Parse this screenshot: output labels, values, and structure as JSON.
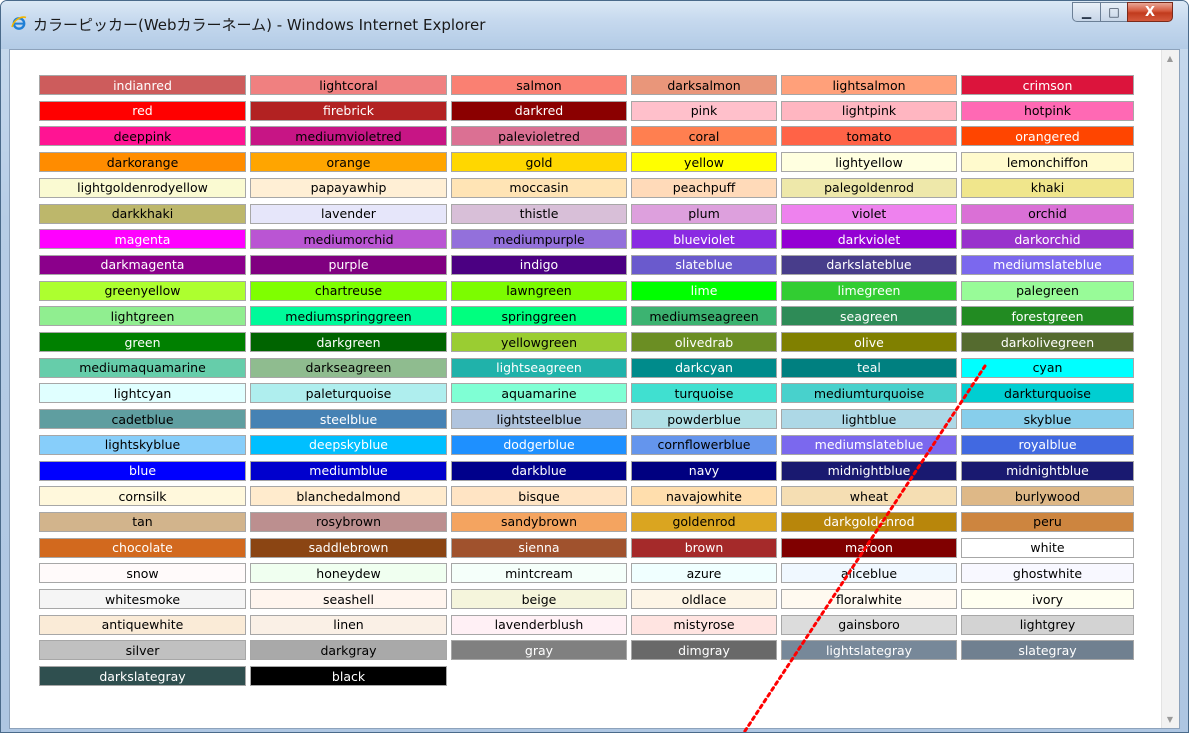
{
  "window": {
    "title": "カラーピッカー(Webカラーネーム) - Windows Internet Explorer",
    "icons": {
      "app": "ie-icon",
      "minimize": "minimize-icon",
      "maximize": "maximize-icon",
      "close": "close-icon"
    },
    "controls": {
      "minimize": "▁",
      "maximize": "□",
      "close": "X"
    }
  },
  "scrollbar": {
    "up": "▲",
    "down": "▼"
  },
  "colors": [
    {
      "name": "indianred",
      "hex": "#CD5C5C",
      "text": "#ffffff"
    },
    {
      "name": "lightcoral",
      "hex": "#F08080",
      "text": "#000000"
    },
    {
      "name": "salmon",
      "hex": "#FA8072",
      "text": "#000000"
    },
    {
      "name": "darksalmon",
      "hex": "#E9967A",
      "text": "#000000"
    },
    {
      "name": "lightsalmon",
      "hex": "#FFA07A",
      "text": "#000000"
    },
    {
      "name": "crimson",
      "hex": "#DC143C",
      "text": "#ffffff"
    },
    {
      "name": "red",
      "hex": "#FF0000",
      "text": "#ffffff"
    },
    {
      "name": "firebrick",
      "hex": "#B22222",
      "text": "#ffffff"
    },
    {
      "name": "darkred",
      "hex": "#8B0000",
      "text": "#ffffff"
    },
    {
      "name": "pink",
      "hex": "#FFC0CB",
      "text": "#000000"
    },
    {
      "name": "lightpink",
      "hex": "#FFB6C1",
      "text": "#000000"
    },
    {
      "name": "hotpink",
      "hex": "#FF69B4",
      "text": "#000000"
    },
    {
      "name": "deeppink",
      "hex": "#FF1493",
      "text": "#000000"
    },
    {
      "name": "mediumvioletred",
      "hex": "#C71585",
      "text": "#000000"
    },
    {
      "name": "palevioletred",
      "hex": "#DB7093",
      "text": "#000000"
    },
    {
      "name": "coral",
      "hex": "#FF7F50",
      "text": "#000000"
    },
    {
      "name": "tomato",
      "hex": "#FF6347",
      "text": "#000000"
    },
    {
      "name": "orangered",
      "hex": "#FF4500",
      "text": "#ffffff"
    },
    {
      "name": "darkorange",
      "hex": "#FF8C00",
      "text": "#000000"
    },
    {
      "name": "orange",
      "hex": "#FFA500",
      "text": "#000000"
    },
    {
      "name": "gold",
      "hex": "#FFD700",
      "text": "#000000"
    },
    {
      "name": "yellow",
      "hex": "#FFFF00",
      "text": "#000000"
    },
    {
      "name": "lightyellow",
      "hex": "#FFFFE0",
      "text": "#000000"
    },
    {
      "name": "lemonchiffon",
      "hex": "#FFFACD",
      "text": "#000000"
    },
    {
      "name": "lightgoldenrodyellow",
      "hex": "#FAFAD2",
      "text": "#000000"
    },
    {
      "name": "papayawhip",
      "hex": "#FFEFD5",
      "text": "#000000"
    },
    {
      "name": "moccasin",
      "hex": "#FFE4B5",
      "text": "#000000"
    },
    {
      "name": "peachpuff",
      "hex": "#FFDAB9",
      "text": "#000000"
    },
    {
      "name": "palegoldenrod",
      "hex": "#EEE8AA",
      "text": "#000000"
    },
    {
      "name": "khaki",
      "hex": "#F0E68C",
      "text": "#000000"
    },
    {
      "name": "darkkhaki",
      "hex": "#BDB76B",
      "text": "#000000"
    },
    {
      "name": "lavender",
      "hex": "#E6E6FA",
      "text": "#000000"
    },
    {
      "name": "thistle",
      "hex": "#D8BFD8",
      "text": "#000000"
    },
    {
      "name": "plum",
      "hex": "#DDA0DD",
      "text": "#000000"
    },
    {
      "name": "violet",
      "hex": "#EE82EE",
      "text": "#000000"
    },
    {
      "name": "orchid",
      "hex": "#DA70D6",
      "text": "#000000"
    },
    {
      "name": "magenta",
      "hex": "#FF00FF",
      "text": "#ffffff"
    },
    {
      "name": "mediumorchid",
      "hex": "#BA55D3",
      "text": "#000000"
    },
    {
      "name": "mediumpurple",
      "hex": "#9370DB",
      "text": "#000000"
    },
    {
      "name": "blueviolet",
      "hex": "#8A2BE2",
      "text": "#ffffff"
    },
    {
      "name": "darkviolet",
      "hex": "#9400D3",
      "text": "#ffffff"
    },
    {
      "name": "darkorchid",
      "hex": "#9932CC",
      "text": "#ffffff"
    },
    {
      "name": "darkmagenta",
      "hex": "#8B008B",
      "text": "#ffffff"
    },
    {
      "name": "purple",
      "hex": "#800080",
      "text": "#ffffff"
    },
    {
      "name": "indigo",
      "hex": "#4B0082",
      "text": "#ffffff"
    },
    {
      "name": "slateblue",
      "hex": "#6A5ACD",
      "text": "#ffffff"
    },
    {
      "name": "darkslateblue",
      "hex": "#483D8B",
      "text": "#ffffff"
    },
    {
      "name": "mediumslateblue",
      "hex": "#7B68EE",
      "text": "#ffffff"
    },
    {
      "name": "greenyellow",
      "hex": "#ADFF2F",
      "text": "#000000"
    },
    {
      "name": "chartreuse",
      "hex": "#7FFF00",
      "text": "#000000"
    },
    {
      "name": "lawngreen",
      "hex": "#7CFC00",
      "text": "#000000"
    },
    {
      "name": "lime",
      "hex": "#00FF00",
      "text": "#ffffff"
    },
    {
      "name": "limegreen",
      "hex": "#32CD32",
      "text": "#ffffff"
    },
    {
      "name": "palegreen",
      "hex": "#98FB98",
      "text": "#000000"
    },
    {
      "name": "lightgreen",
      "hex": "#90EE90",
      "text": "#000000"
    },
    {
      "name": "mediumspringgreen",
      "hex": "#00FA9A",
      "text": "#000000"
    },
    {
      "name": "springgreen",
      "hex": "#00FF7F",
      "text": "#000000"
    },
    {
      "name": "mediumseagreen",
      "hex": "#3CB371",
      "text": "#000000"
    },
    {
      "name": "seagreen",
      "hex": "#2E8B57",
      "text": "#ffffff"
    },
    {
      "name": "forestgreen",
      "hex": "#228B22",
      "text": "#ffffff"
    },
    {
      "name": "green",
      "hex": "#008000",
      "text": "#ffffff"
    },
    {
      "name": "darkgreen",
      "hex": "#006400",
      "text": "#ffffff"
    },
    {
      "name": "yellowgreen",
      "hex": "#9ACD32",
      "text": "#000000"
    },
    {
      "name": "olivedrab",
      "hex": "#6B8E23",
      "text": "#ffffff"
    },
    {
      "name": "olive",
      "hex": "#808000",
      "text": "#ffffff"
    },
    {
      "name": "darkolivegreen",
      "hex": "#556B2F",
      "text": "#ffffff"
    },
    {
      "name": "mediumaquamarine",
      "hex": "#66CDAA",
      "text": "#000000"
    },
    {
      "name": "darkseagreen",
      "hex": "#8FBC8F",
      "text": "#000000"
    },
    {
      "name": "lightseagreen",
      "hex": "#20B2AA",
      "text": "#ffffff"
    },
    {
      "name": "darkcyan",
      "hex": "#008B8B",
      "text": "#ffffff"
    },
    {
      "name": "teal",
      "hex": "#008080",
      "text": "#ffffff"
    },
    {
      "name": "cyan",
      "hex": "#00FFFF",
      "text": "#000000"
    },
    {
      "name": "lightcyan",
      "hex": "#E0FFFF",
      "text": "#000000"
    },
    {
      "name": "paleturquoise",
      "hex": "#AFEEEE",
      "text": "#000000"
    },
    {
      "name": "aquamarine",
      "hex": "#7FFFD4",
      "text": "#000000"
    },
    {
      "name": "turquoise",
      "hex": "#40E0D0",
      "text": "#000000"
    },
    {
      "name": "mediumturquoise",
      "hex": "#48D1CC",
      "text": "#000000"
    },
    {
      "name": "darkturquoise",
      "hex": "#00CED1",
      "text": "#000000"
    },
    {
      "name": "cadetblue",
      "hex": "#5F9EA0",
      "text": "#000000"
    },
    {
      "name": "steelblue",
      "hex": "#4682B4",
      "text": "#ffffff"
    },
    {
      "name": "lightsteelblue",
      "hex": "#B0C4DE",
      "text": "#000000"
    },
    {
      "name": "powderblue",
      "hex": "#B0E0E6",
      "text": "#000000"
    },
    {
      "name": "lightblue",
      "hex": "#ADD8E6",
      "text": "#000000"
    },
    {
      "name": "skyblue",
      "hex": "#87CEEB",
      "text": "#000000"
    },
    {
      "name": "lightskyblue",
      "hex": "#87CEFA",
      "text": "#000000"
    },
    {
      "name": "deepskyblue",
      "hex": "#00BFFF",
      "text": "#ffffff"
    },
    {
      "name": "dodgerblue",
      "hex": "#1E90FF",
      "text": "#ffffff"
    },
    {
      "name": "cornflowerblue",
      "hex": "#6495ED",
      "text": "#000000"
    },
    {
      "name": "mediumslateblue",
      "hex": "#7B68EE",
      "text": "#ffffff"
    },
    {
      "name": "royalblue",
      "hex": "#4169E1",
      "text": "#ffffff"
    },
    {
      "name": "blue",
      "hex": "#0000FF",
      "text": "#ffffff"
    },
    {
      "name": "mediumblue",
      "hex": "#0000CD",
      "text": "#ffffff"
    },
    {
      "name": "darkblue",
      "hex": "#00008B",
      "text": "#ffffff"
    },
    {
      "name": "navy",
      "hex": "#000080",
      "text": "#ffffff"
    },
    {
      "name": "midnightblue",
      "hex": "#191970",
      "text": "#ffffff"
    },
    {
      "name": "midnightblue",
      "hex": "#191970",
      "text": "#ffffff"
    },
    {
      "name": "cornsilk",
      "hex": "#FFF8DC",
      "text": "#000000"
    },
    {
      "name": "blanchedalmond",
      "hex": "#FFEBCD",
      "text": "#000000"
    },
    {
      "name": "bisque",
      "hex": "#FFE4C4",
      "text": "#000000"
    },
    {
      "name": "navajowhite",
      "hex": "#FFDEAD",
      "text": "#000000"
    },
    {
      "name": "wheat",
      "hex": "#F5DEB3",
      "text": "#000000"
    },
    {
      "name": "burlywood",
      "hex": "#DEB887",
      "text": "#000000"
    },
    {
      "name": "tan",
      "hex": "#D2B48C",
      "text": "#000000"
    },
    {
      "name": "rosybrown",
      "hex": "#BC8F8F",
      "text": "#000000"
    },
    {
      "name": "sandybrown",
      "hex": "#F4A460",
      "text": "#000000"
    },
    {
      "name": "goldenrod",
      "hex": "#DAA520",
      "text": "#000000"
    },
    {
      "name": "darkgoldenrod",
      "hex": "#B8860B",
      "text": "#ffffff"
    },
    {
      "name": "peru",
      "hex": "#CD853F",
      "text": "#000000"
    },
    {
      "name": "chocolate",
      "hex": "#D2691E",
      "text": "#ffffff"
    },
    {
      "name": "saddlebrown",
      "hex": "#8B4513",
      "text": "#ffffff"
    },
    {
      "name": "sienna",
      "hex": "#A0522D",
      "text": "#ffffff"
    },
    {
      "name": "brown",
      "hex": "#A52A2A",
      "text": "#ffffff"
    },
    {
      "name": "maroon",
      "hex": "#800000",
      "text": "#ffffff"
    },
    {
      "name": "white",
      "hex": "#FFFFFF",
      "text": "#000000"
    },
    {
      "name": "snow",
      "hex": "#FFFAFA",
      "text": "#000000"
    },
    {
      "name": "honeydew",
      "hex": "#F0FFF0",
      "text": "#000000"
    },
    {
      "name": "mintcream",
      "hex": "#F5FFFA",
      "text": "#000000"
    },
    {
      "name": "azure",
      "hex": "#F0FFFF",
      "text": "#000000"
    },
    {
      "name": "aliceblue",
      "hex": "#F0F8FF",
      "text": "#000000"
    },
    {
      "name": "ghostwhite",
      "hex": "#F8F8FF",
      "text": "#000000"
    },
    {
      "name": "whitesmoke",
      "hex": "#F5F5F5",
      "text": "#000000"
    },
    {
      "name": "seashell",
      "hex": "#FFF5EE",
      "text": "#000000"
    },
    {
      "name": "beige",
      "hex": "#F5F5DC",
      "text": "#000000"
    },
    {
      "name": "oldlace",
      "hex": "#FDF5E6",
      "text": "#000000"
    },
    {
      "name": "floralwhite",
      "hex": "#FFFAF0",
      "text": "#000000"
    },
    {
      "name": "ivory",
      "hex": "#FFFFF0",
      "text": "#000000"
    },
    {
      "name": "antiquewhite",
      "hex": "#FAEBD7",
      "text": "#000000"
    },
    {
      "name": "linen",
      "hex": "#FAF0E6",
      "text": "#000000"
    },
    {
      "name": "lavenderblush",
      "hex": "#FFF0F5",
      "text": "#000000"
    },
    {
      "name": "mistyrose",
      "hex": "#FFE4E1",
      "text": "#000000"
    },
    {
      "name": "gainsboro",
      "hex": "#DCDCDC",
      "text": "#000000"
    },
    {
      "name": "lightgrey",
      "hex": "#D3D3D3",
      "text": "#000000"
    },
    {
      "name": "silver",
      "hex": "#C0C0C0",
      "text": "#000000"
    },
    {
      "name": "darkgray",
      "hex": "#A9A9A9",
      "text": "#000000"
    },
    {
      "name": "gray",
      "hex": "#808080",
      "text": "#ffffff"
    },
    {
      "name": "dimgray",
      "hex": "#696969",
      "text": "#ffffff"
    },
    {
      "name": "lightslategray",
      "hex": "#778899",
      "text": "#ffffff"
    },
    {
      "name": "slategray",
      "hex": "#708090",
      "text": "#ffffff"
    },
    {
      "name": "darkslategray",
      "hex": "#2F4F4F",
      "text": "#ffffff"
    },
    {
      "name": "black",
      "hex": "#000000",
      "text": "#ffffff"
    }
  ],
  "annotation": {
    "type": "red-dotted-line",
    "color": "#ff0000"
  }
}
